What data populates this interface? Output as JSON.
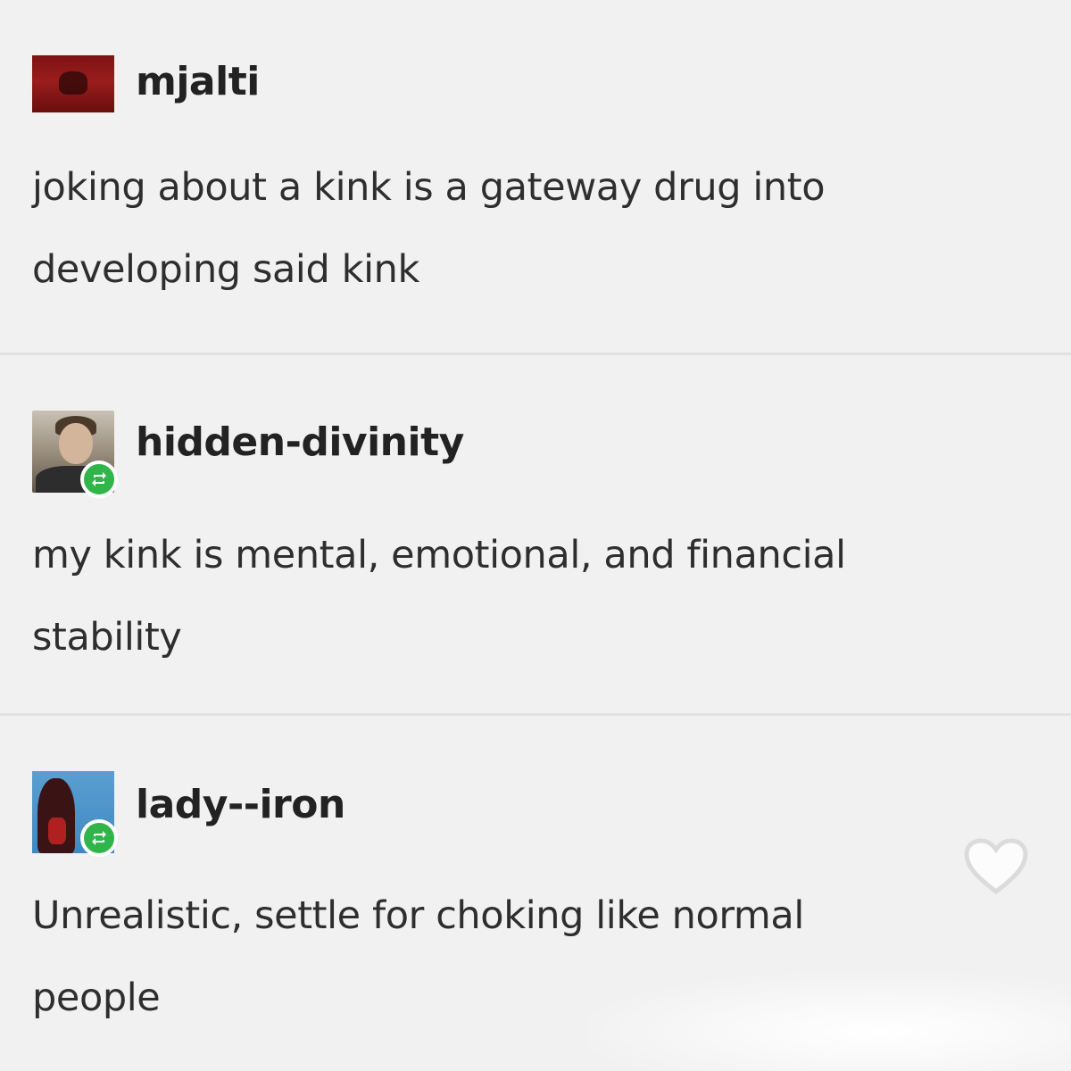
{
  "posts": [
    {
      "username": "mjalti",
      "avatar_icon": "albanian-flag-avatar",
      "reblog": false,
      "lines": [
        "joking about a kink is a gateway drug into",
        "developing said kink"
      ]
    },
    {
      "username": "hidden-divinity",
      "avatar_icon": "portrait-avatar",
      "reblog": true,
      "lines": [
        "my kink is mental, emotional, and financial",
        "stability"
      ]
    },
    {
      "username": "lady--iron",
      "avatar_icon": "character-avatar",
      "reblog": true,
      "lines": [
        "Unrealistic, settle for choking like normal",
        "people"
      ]
    }
  ],
  "actions": {
    "like_icon": "heart-icon"
  },
  "colors": {
    "background": "#f1f1f1",
    "reblog_badge": "#2fb54a",
    "flag_red": "#8b1717"
  }
}
